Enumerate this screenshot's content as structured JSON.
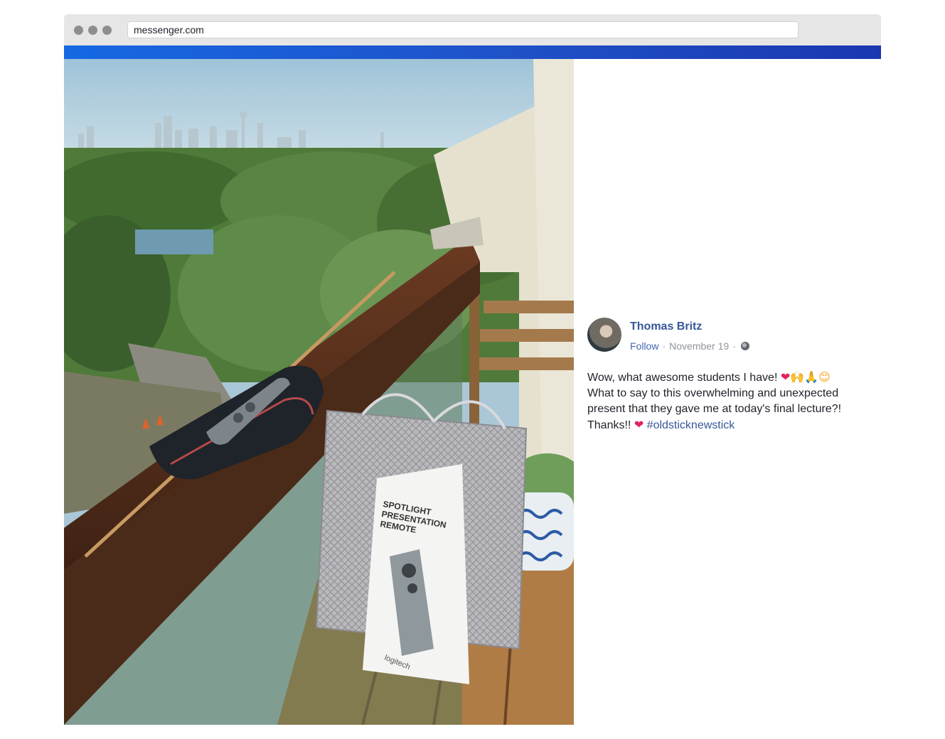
{
  "browser": {
    "url": "messenger.com"
  },
  "post": {
    "author": "Thomas Britz",
    "follow_label": "Follow",
    "separator": "·",
    "date": "November 19",
    "line1": "Wow, what awesome students I have!",
    "line2": "What to say to this overwhelming and unexpected",
    "line3": "present that they gave me at today's final lecture?!",
    "line4": "Thanks!!",
    "hashtag": "#oldsticknewstick",
    "emoji_heart": "❤",
    "emoji_raised_hands": "🙌",
    "emoji_pray": "🙏",
    "emoji_smile": "😊"
  },
  "photo": {
    "box_text_line1": "SPOTLIGHT",
    "box_text_line2": "PRESENTATION",
    "box_text_line3": "REMOTE",
    "box_brand": "logitech"
  },
  "colors": {
    "accent_bar": "#1f51c8",
    "author_link": "#365899",
    "meta_gray": "#90949c"
  }
}
